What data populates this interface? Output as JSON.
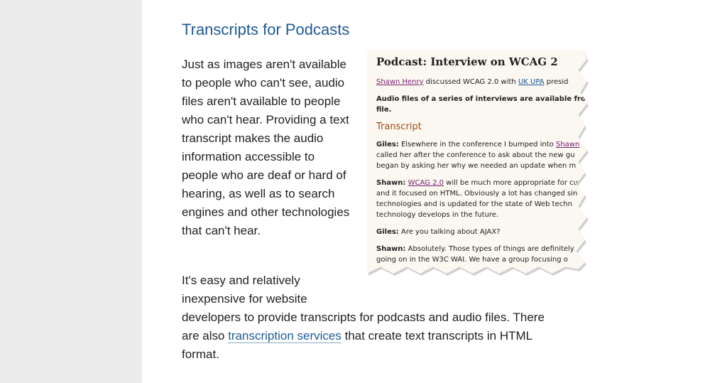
{
  "section": {
    "title": "Transcripts for Podcasts"
  },
  "para1": {
    "text": "Just as images aren't available to people who can't see, audio files aren't available to people who can't hear. Providing a text transcript makes the audio information accessible to people who are deaf or hard of hearing, as well as to search engines and other technologies that can't hear."
  },
  "para2": {
    "line_a": "It's easy and relatively",
    "line_b": "inexpensive for website",
    "rest_before": "developers to provide transcripts for podcasts and audio files. There are also ",
    "link": "transcription services",
    "rest_after": " that create text transcripts in HTML format."
  },
  "screenshot": {
    "title": "Podcast: Interview on WCAG 2",
    "intro_link1": "Shawn Henry",
    "intro_mid": " discussed WCAG 2.0 with ",
    "intro_link2": "UK UPA",
    "intro_end": " presid",
    "audio_line1": "Audio files of a series of interviews are available from t",
    "audio_line2": "file.",
    "heading": "Transcript",
    "giles1_label": "Giles:",
    "giles1_l1": " Elsewhere in the conference I bumped into ",
    "giles1_l1_link": "Shawn",
    "giles1_l2": "called her after the conference to ask about the new gu",
    "giles1_l3": "began by asking her why we needed an update when m",
    "shawn1_label": "Shawn:",
    "shawn1_link": "WCAG 2.0",
    "shawn1_l1": " will be much more appropriate for cu",
    "shawn1_l2": "and it focused on HTML. Obviously a lot has changed sin",
    "shawn1_l3": "technologies and is updated for the state of Web techn",
    "shawn1_l4": "technology develops in the future.",
    "giles2_label": "Giles:",
    "giles2_text": " Are you talking about AJAX?",
    "shawn2_label": "Shawn:",
    "shawn2_l1": " Absolutely. Those types of things are definitely",
    "shawn2_l2": "going on in the W3C WAI. We have a group focusing o"
  },
  "colors": {
    "title": "#1f5a94",
    "link": "#1f5a94",
    "sidebar": "#ececec",
    "transcript_heading": "#a24b1c"
  }
}
